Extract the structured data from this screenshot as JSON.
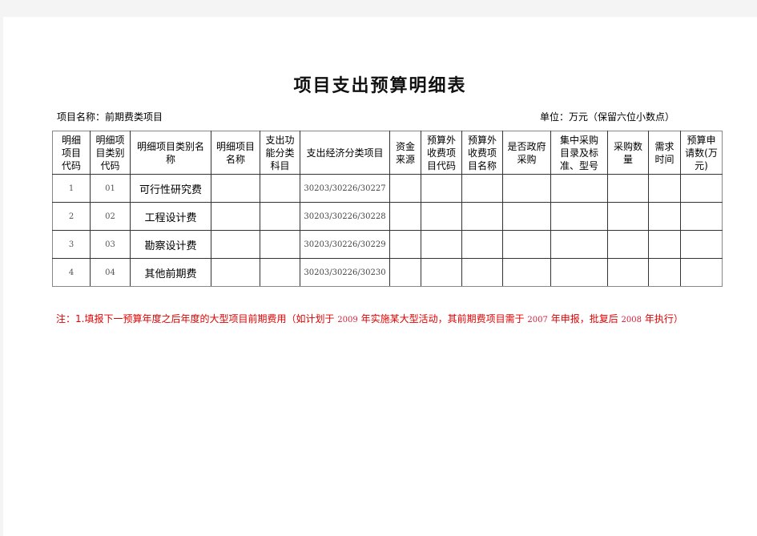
{
  "document": {
    "title": "项目支出预算明细表",
    "project_label": "项目名称：前期费类项目",
    "unit_label": "单位：万元（保留六位小数点）"
  },
  "table": {
    "headers": [
      "明细项目代码",
      "明细项目类别代码",
      "明细项目类别名称",
      "明细项目名称",
      "支出功能分类科目",
      "支出经济分类项目",
      "资金来源",
      "预算外收费项目代码",
      "预算外收费项目名称",
      "是否政府采购",
      "集中采购目录及标准、型号",
      "采购数量",
      "需求时间",
      "预算申请数(万元)"
    ],
    "rows": [
      {
        "code": "1",
        "category_code": "01",
        "category_name": "可行性研究费",
        "econ_class": "30203/30226/30227"
      },
      {
        "code": "2",
        "category_code": "02",
        "category_name": "工程设计费",
        "econ_class": "30203/30226/30228"
      },
      {
        "code": "3",
        "category_code": "03",
        "category_name": "勘察设计费",
        "econ_class": "30203/30226/30229"
      },
      {
        "code": "4",
        "category_code": "04",
        "category_name": "其他前期费",
        "econ_class": "30203/30226/30230"
      }
    ]
  },
  "note": {
    "part1": "注：1.填报下一预算年度之后年度的大型项目前期费用（如计划于",
    "year1": "2009",
    "part2": "年实施某大型活动，其前期费项目需于",
    "year2": "2007",
    "part3": "年申报，批复后",
    "year3": "2008",
    "part4": "年执行）"
  },
  "colors": {
    "note_text": "#e00000",
    "page_background": "#f4f4f4"
  }
}
